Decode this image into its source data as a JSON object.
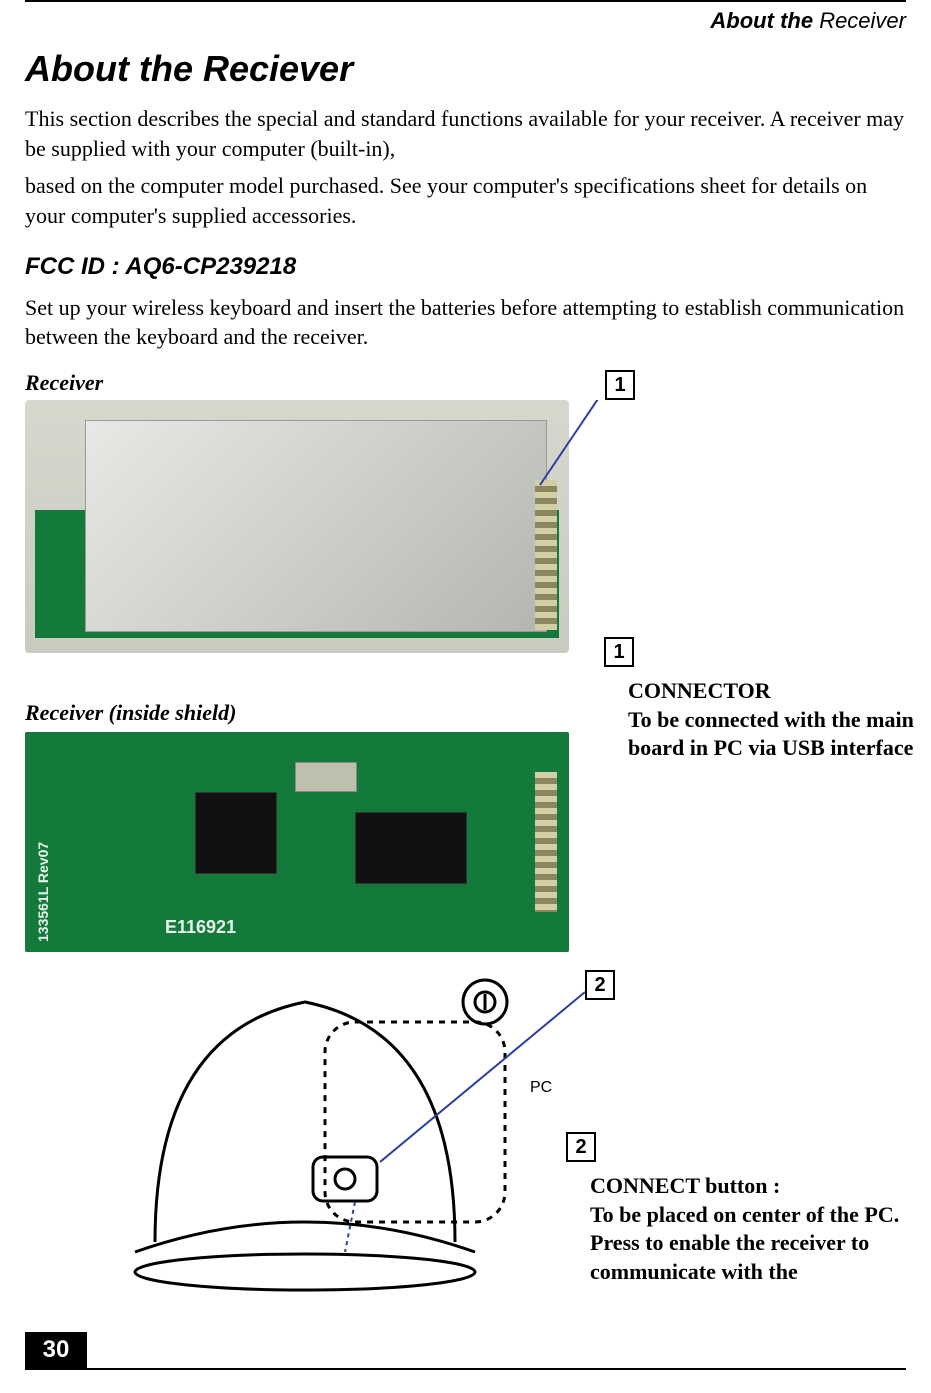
{
  "header": {
    "bold": "About the ",
    "light": "Receiver"
  },
  "title": "About the Reciever",
  "intro_p1": "This section describes the special and standard functions available for your receiver. A receiver may be supplied with your computer (built-in),",
  "intro_p2": "based on the computer model purchased. See your computer's specifications sheet for details on your computer's supplied accessories.",
  "fcc": "FCC ID : AQ6-CP239218",
  "setup": "Set up your wireless keyboard and insert the batteries before attempting to establish communication between the keyboard and the receiver.",
  "label_receiver": "Receiver",
  "label_inside": "Receiver (inside shield)",
  "silk_e": "E116921",
  "silk_rev": "133561L  Rev07",
  "callouts": {
    "one": {
      "num": "1",
      "title": "CONNECTOR",
      "desc": "To be connected with the main board in PC via USB interface"
    },
    "two": {
      "num": "2",
      "title": "CONNECT button :",
      "desc1": "To be placed on center of the PC.",
      "desc2": "Press to enable the receiver to communicate with the"
    }
  },
  "page_number": "30"
}
